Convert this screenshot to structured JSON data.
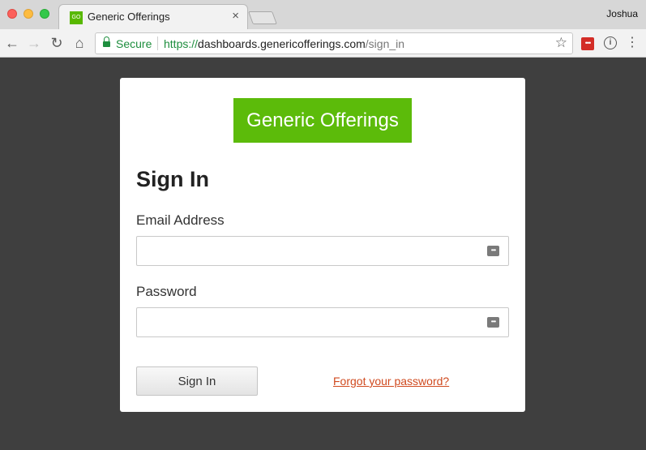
{
  "browser": {
    "tab": {
      "favicon_text": "GO",
      "title": "Generic Offerings",
      "close_glyph": "×"
    },
    "profile_name": "Joshua",
    "toolbar": {
      "back_glyph": "←",
      "forward_glyph": "→",
      "reload_glyph": "↻",
      "home_glyph": "⌂",
      "security_label": "Secure",
      "url_scheme": "https://",
      "url_host": "dashboards.genericofferings.com",
      "url_path": "/sign_in",
      "star_glyph": "☆",
      "lastpass_glyph": "•••",
      "info_glyph": "i",
      "menu_glyph": "⋮"
    }
  },
  "page": {
    "logo_text": "Generic Offerings",
    "heading": "Sign In",
    "email": {
      "label": "Email Address",
      "value": "",
      "placeholder": ""
    },
    "password": {
      "label": "Password",
      "value": "",
      "placeholder": ""
    },
    "autofill_glyph": "•••",
    "sign_in_label": "Sign In",
    "forgot_link": "Forgot your password?"
  },
  "colors": {
    "page_background": "#3f3f3f",
    "brand_green": "#5cbb0a",
    "secure_green": "#1e8e3e",
    "link_color": "#d04a1f"
  }
}
